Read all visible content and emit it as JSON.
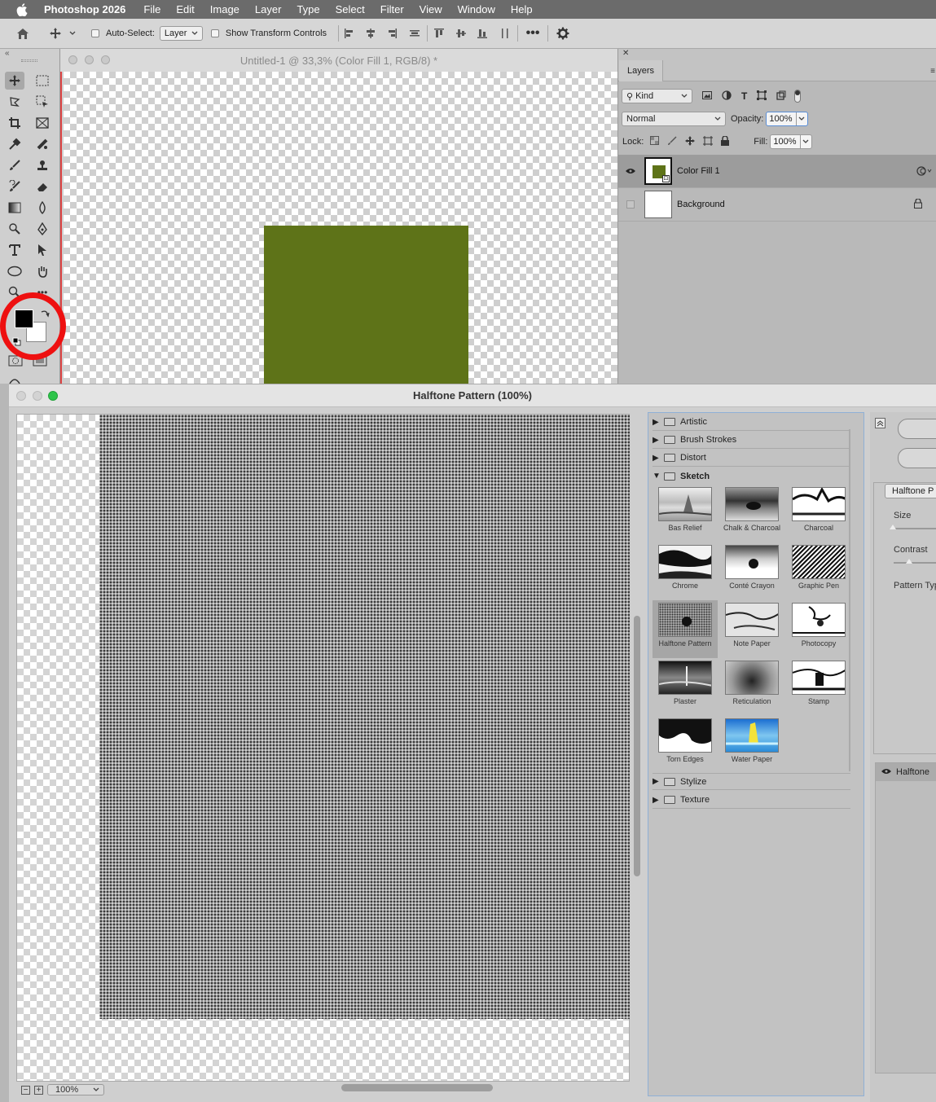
{
  "menubar": {
    "app_name": "Photoshop 2026",
    "items": [
      "File",
      "Edit",
      "Image",
      "Layer",
      "Type",
      "Select",
      "Filter",
      "View",
      "Window",
      "Help"
    ]
  },
  "options_bar": {
    "auto_select_label": "Auto-Select:",
    "auto_select_value": "Layer",
    "show_transform_label": "Show Transform Controls"
  },
  "document": {
    "title": "Untitled-1 @ 33,3% (Color Fill 1, RGB/8) *",
    "fill_color": "#5e7318"
  },
  "layers_panel": {
    "tab": "Layers",
    "filter_kind": "Kind",
    "blend_mode": "Normal",
    "opacity_label": "Opacity:",
    "opacity_value": "100%",
    "lock_label": "Lock:",
    "fill_label": "Fill:",
    "fill_value": "100%",
    "layers": [
      {
        "name": "Color Fill 1",
        "visible": true,
        "selected": true
      },
      {
        "name": "Background",
        "visible": false,
        "selected": false
      }
    ]
  },
  "filter_gallery": {
    "title": "Halftone Pattern (100%)",
    "zoom": "100%",
    "categories_top": [
      {
        "name": "Artistic",
        "expanded": false
      },
      {
        "name": "Brush Strokes",
        "expanded": false
      },
      {
        "name": "Distort",
        "expanded": false
      },
      {
        "name": "Sketch",
        "expanded": true
      }
    ],
    "sketch_filters": [
      "Bas Relief",
      "Chalk & Charcoal",
      "Charcoal",
      "Chrome",
      "Conté Crayon",
      "Graphic Pen",
      "Halftone Pattern",
      "Note Paper",
      "Photocopy",
      "Plaster",
      "Reticulation",
      "Stamp",
      "Torn Edges",
      "Water Paper"
    ],
    "selected_filter": "Halftone Pattern",
    "categories_bottom": [
      {
        "name": "Stylize",
        "expanded": false
      },
      {
        "name": "Texture",
        "expanded": false
      }
    ],
    "params": {
      "filter_select": "Halftone P",
      "size_label": "Size",
      "contrast_label": "Contrast",
      "pattern_type_label": "Pattern Typ"
    },
    "effect_layer": "Halftone"
  }
}
